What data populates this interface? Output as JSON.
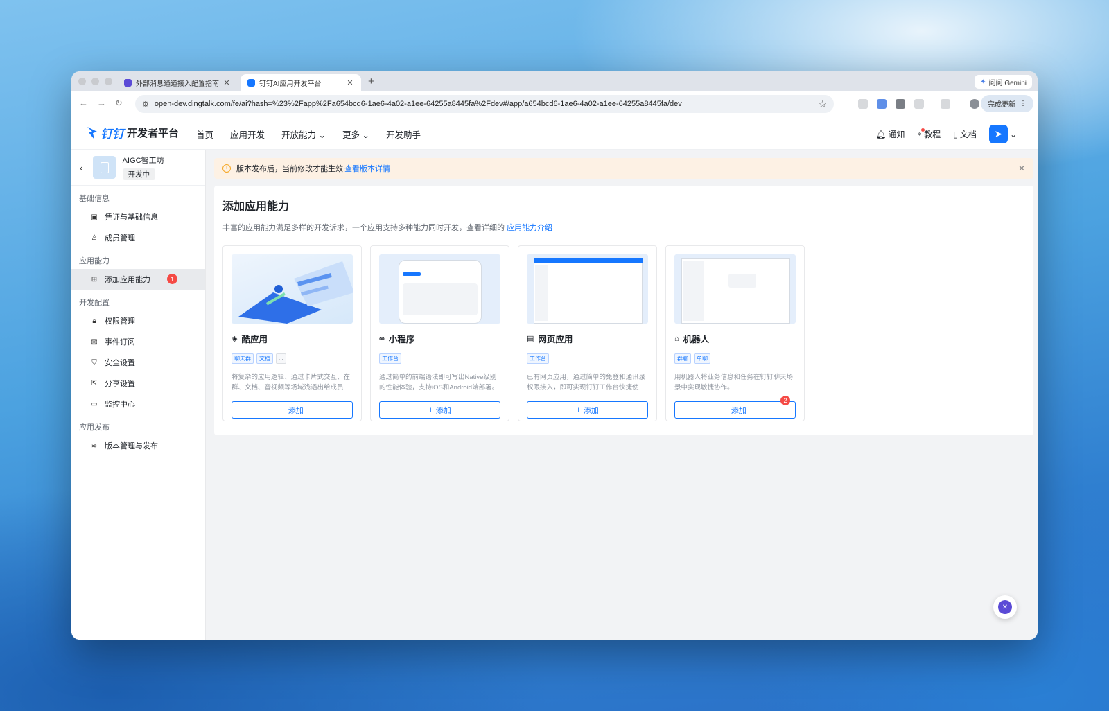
{
  "browser": {
    "tabs": [
      {
        "title": "外部消息通道接入配置指南"
      },
      {
        "title": "钉钉AI应用开发平台"
      }
    ],
    "new_tab": "+",
    "gemini": "问问 Gemini",
    "url": "open-dev.dingtalk.com/fe/ai?hash=%23%2Fapp%2Fa654bcd6-1ae6-4a02-a1ee-64255a8445fa%2Fdev#/app/a654bcd6-1ae6-4a02-a1ee-64255a8445fa/dev",
    "update_label": "完成更新"
  },
  "header": {
    "brand": "钉钉",
    "platform": "开发者平台",
    "nav": [
      "首页",
      "应用开发",
      "开放能力",
      "更多",
      "开发助手"
    ],
    "notify": "通知",
    "tutorial": "教程",
    "docs": "文档"
  },
  "sidebar": {
    "app_name": "AIGC智工坊",
    "app_status": "开发中",
    "sections": [
      {
        "title": "基础信息",
        "items": [
          "凭证与基础信息",
          "成员管理"
        ]
      },
      {
        "title": "应用能力",
        "items": [
          "添加应用能力"
        ]
      },
      {
        "title": "开发配置",
        "items": [
          "权限管理",
          "事件订阅",
          "安全设置",
          "分享设置",
          "监控中心"
        ]
      },
      {
        "title": "应用发布",
        "items": [
          "版本管理与发布"
        ]
      }
    ],
    "active_badge": "1"
  },
  "notice": {
    "text": "版本发布后，当前修改才能生效",
    "link": "查看版本详情"
  },
  "main": {
    "title": "添加应用能力",
    "desc": "丰富的应用能力满足多样的开发诉求，一个应用支持多种能力同时开发，查看详细的",
    "desc_link": "应用能力介绍",
    "add_label": "添加",
    "cards": [
      {
        "title": "酷应用",
        "tags": [
          "聊天群",
          "文档",
          "..."
        ],
        "desc": "将复杂的应用逻辑、通过卡片式交互、在群、文档、音视频等场域浅透出给成员快..."
      },
      {
        "title": "小程序",
        "tags": [
          "工作台"
        ],
        "desc": "通过简单的前端语法即可写出Native级别的性能体验，支持iOS和Android端部署。"
      },
      {
        "title": "网页应用",
        "tags": [
          "工作台"
        ],
        "desc": "已有网页应用，通过简单的免登和通讯录权限接入，即可实现钉钉工作台快捷使用。"
      },
      {
        "title": "机器人",
        "tags": [
          "群聊",
          "单聊"
        ],
        "desc": "用机器人将业务信息和任务在钉钉聊天场景中实现敏捷协作。"
      }
    ],
    "card_badge": "2"
  }
}
